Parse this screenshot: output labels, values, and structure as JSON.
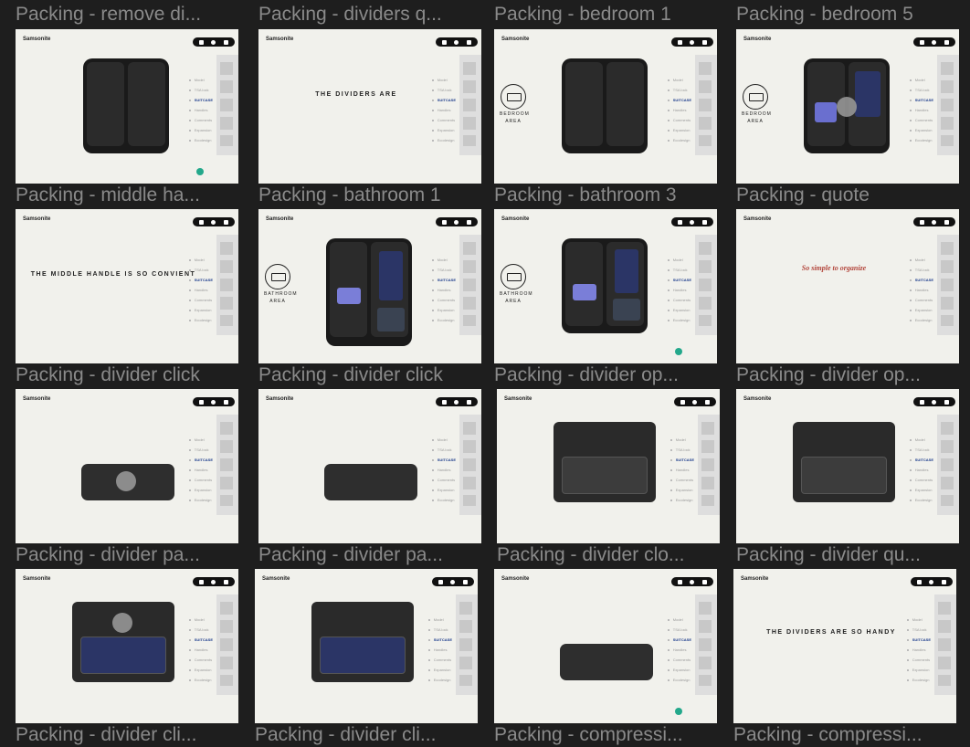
{
  "brand": "Samsonite",
  "nav_items": [
    "Model",
    "TSA lock",
    "SUITCASE",
    "Packing",
    "Handles",
    "Comments",
    "Expansion",
    "Ecodesign"
  ],
  "cards": [
    {
      "id": "c1",
      "label": "Packing - remove di..."
    },
    {
      "id": "c2",
      "label": "Packing - dividers q..."
    },
    {
      "id": "c3",
      "label": "Packing - bedroom 1"
    },
    {
      "id": "c4",
      "label": "Packing - bedroom 5"
    },
    {
      "id": "c5",
      "label": "Packing - middle ha..."
    },
    {
      "id": "c6",
      "label": "Packing - bathroom 1"
    },
    {
      "id": "c7",
      "label": "Packing - bathroom 3"
    },
    {
      "id": "c8",
      "label": "Packing - quote"
    },
    {
      "id": "c9",
      "label": "Packing - divider click"
    },
    {
      "id": "c10",
      "label": "Packing - divider click"
    },
    {
      "id": "c11",
      "label": "Packing - divider op..."
    },
    {
      "id": "c12",
      "label": "Packing - divider op..."
    },
    {
      "id": "c13",
      "label": "Packing - divider pa..."
    },
    {
      "id": "c14",
      "label": "Packing - divider pa..."
    },
    {
      "id": "c15",
      "label": "Packing - divider clo..."
    },
    {
      "id": "c16",
      "label": "Packing - divider qu..."
    },
    {
      "id": "c17",
      "label": "Packing - divider cli..."
    },
    {
      "id": "c18",
      "label": "Packing - divider cli..."
    },
    {
      "id": "c19",
      "label": "Packing - compressi..."
    },
    {
      "id": "c20",
      "label": "Packing - compressi..."
    }
  ],
  "frame_text": {
    "dividers_are": "THE DIVIDERS ARE",
    "middle_handle": "THE MIDDLE HANDLE IS SO CONVIENT",
    "quote": "So simple to organize",
    "dividers_handy": "THE DIVIDERS ARE SO HANDY",
    "bedroom": "BEDROOM",
    "bathroom": "BATHROOM",
    "area": "AREA"
  },
  "colors": {
    "canvas": "#1e1e1e",
    "frame": "#f1f1ec",
    "accent_nav": "#1c3c8c",
    "quote": "#b2443a",
    "check": "#23a88b"
  }
}
